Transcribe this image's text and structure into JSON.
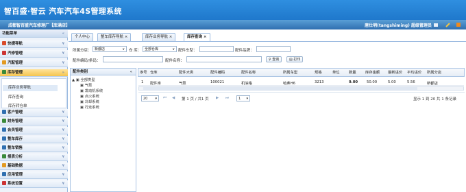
{
  "app": {
    "title": "智百盛·智云 汽车汽车4S管理系统",
    "store": "成都智百盛汽车修理厂【库满店】",
    "user": "唐仕明(tangshiming)  超级管理员"
  },
  "sidebar": {
    "title": "功能菜单",
    "sections": [
      {
        "label": "快捷导航",
        "color": "#d94b2b"
      },
      {
        "label": "汽修管理",
        "color": "#c33"
      },
      {
        "label": "汽配管理",
        "color": "#e29a22"
      },
      {
        "label": "库存管理",
        "color": "#3a8a3a"
      }
    ],
    "subitems": [
      "库存业务导航",
      "库存查询",
      "库存转仓单"
    ],
    "sections2": [
      {
        "label": "客户管理",
        "color": "#2f6fb0"
      },
      {
        "label": "财务管理",
        "color": "#3a8a3a"
      },
      {
        "label": "会员管理",
        "color": "#2f6fb0"
      },
      {
        "label": "整车库存",
        "color": "#2f6fb0"
      },
      {
        "label": "整车销售",
        "color": "#2f6fb0"
      },
      {
        "label": "报表分析",
        "color": "#3a8a3a"
      },
      {
        "label": "基础数据",
        "color": "#e29a22"
      },
      {
        "label": "应用管理",
        "color": "#2f6fb0"
      },
      {
        "label": "系统设置",
        "color": "#c33"
      }
    ]
  },
  "tabs": [
    "个人中心",
    "整车库存导航",
    "库存业务导航",
    "库存查询"
  ],
  "filters": {
    "warehouse_label": "所属分店：",
    "warehouse": "新都店",
    "store_label": "仓 库：",
    "store": "全部仓库",
    "parttype_label": "配件车型：",
    "brand_label": "配件品牌：",
    "code_label": "配件编码/条码：",
    "name_label": "配件名称：",
    "query": "查询",
    "print": "打印"
  },
  "tree": {
    "title": "配件类别",
    "root": "全部类型",
    "items": [
      "气泵",
      "发动机系统",
      "点火系统",
      "冷却系统",
      "行走系统"
    ]
  },
  "table": {
    "headers": [
      "序号",
      "仓库",
      "配件大类",
      "配件编码",
      "配件名称",
      "所属车型",
      "规格",
      "单位",
      "数量",
      "库存金额",
      "最新进价",
      "平均进价",
      "所属分店"
    ],
    "rows": [
      [
        "1",
        "配件库",
        "气泵",
        "100021",
        "机油格",
        "哈弗H6",
        "3213",
        "",
        "9.00",
        "50.00",
        "5.00",
        "5.56",
        "新都店"
      ]
    ]
  },
  "pager": {
    "size": "20",
    "page_text": "第 1 页 / 共1 页",
    "page": "1",
    "summary": "显示 1 到 20 共 1 条记录"
  }
}
